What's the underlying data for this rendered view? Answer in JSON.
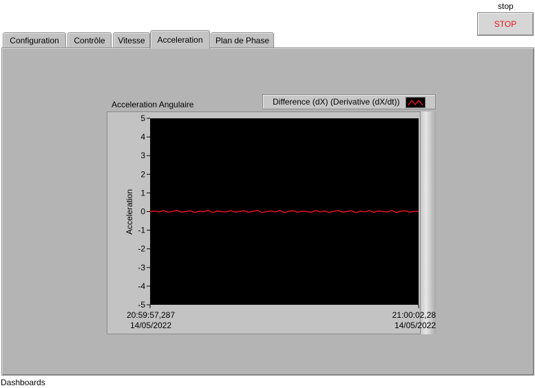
{
  "stop_control": {
    "label": "stop",
    "button": "STOP",
    "button_color": "#e8141c"
  },
  "tabs": [
    {
      "label": "Configuration",
      "active": false
    },
    {
      "label": "Contrôle",
      "active": false
    },
    {
      "label": "Vitesse",
      "active": false
    },
    {
      "label": "Acceleration",
      "active": true
    },
    {
      "label": "Plan de Phase",
      "active": false
    }
  ],
  "graph": {
    "title": "Acceleration Angulaire",
    "legend_label": "Difference (dX) (Derivative (dX/dt))",
    "legend_icon": "red-line-wave-icon"
  },
  "chart_data": {
    "type": "line",
    "title": "Acceleration Angulaire",
    "xlabel": "",
    "ylabel": "Acceleration",
    "ylim": [
      -5,
      5
    ],
    "y_ticks": [
      "5",
      "4",
      "3",
      "2",
      "1",
      "0",
      "-1",
      "-2",
      "-3",
      "-4",
      "-5"
    ],
    "x_ticks": [
      {
        "time": "20:59:57,287",
        "date": "14/05/2022"
      },
      {
        "time": "21:00:02,28",
        "date": "14/05/2022"
      }
    ],
    "grid": false,
    "background": "#000000",
    "series": [
      {
        "name": "Difference (dX) (Derivative (dX/dt))",
        "color": "#e8141c",
        "values": [
          0.0,
          0.03,
          -0.02,
          0.05,
          -0.04,
          0.01,
          0.06,
          -0.03,
          0.0,
          0.04,
          -0.05,
          0.02,
          -0.01,
          0.07,
          -0.06,
          0.03,
          0.0,
          -0.02,
          0.05,
          -0.03,
          0.01,
          0.04,
          -0.04,
          0.02,
          0.06,
          -0.05,
          0.0,
          0.03,
          -0.02,
          0.05,
          -0.06,
          0.01,
          0.04,
          -0.03,
          0.02,
          0.0,
          -0.04,
          0.06,
          -0.02,
          0.03,
          -0.05,
          0.01,
          0.05,
          -0.03,
          0.0,
          0.04,
          -0.06,
          0.02,
          -0.01,
          0.05,
          -0.04,
          0.03,
          0.0,
          -0.02,
          0.06,
          -0.05,
          0.02,
          0.04,
          -0.03,
          0.01,
          0.0
        ]
      }
    ]
  },
  "status_bar": {
    "text": "Dashboards"
  }
}
